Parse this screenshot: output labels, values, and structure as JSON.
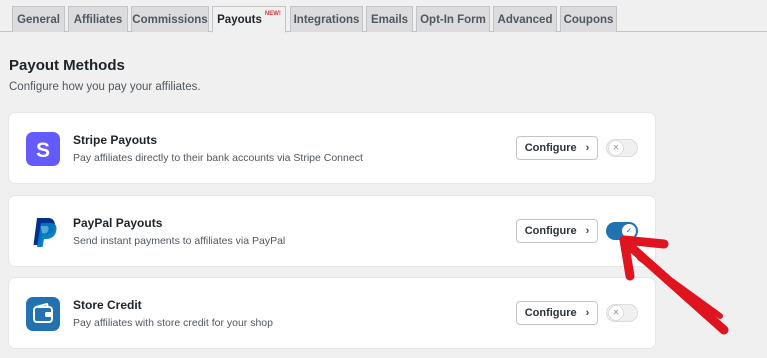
{
  "tabs": [
    {
      "label": "General"
    },
    {
      "label": "Affiliates"
    },
    {
      "label": "Commissions"
    },
    {
      "label": "Payouts",
      "badge": "NEW!",
      "active": true
    },
    {
      "label": "Integrations"
    },
    {
      "label": "Emails"
    },
    {
      "label": "Opt-In Form"
    },
    {
      "label": "Advanced"
    },
    {
      "label": "Coupons"
    }
  ],
  "heading": {
    "title": "Payout Methods",
    "description": "Configure how you pay your affiliates."
  },
  "methods": [
    {
      "name": "Stripe Payouts",
      "description": "Pay affiliates directly to their bank accounts via Stripe Connect",
      "icon": "stripe-logo-icon",
      "button_label": "Configure",
      "enabled": false
    },
    {
      "name": "PayPal Payouts",
      "description": "Send instant payments to affiliates via PayPal",
      "icon": "paypal-logo-icon",
      "button_label": "Configure",
      "enabled": true
    },
    {
      "name": "Store Credit",
      "description": "Pay affiliates with store credit for your shop",
      "icon": "wallet-icon",
      "button_label": "Configure",
      "enabled": false
    }
  ],
  "colors": {
    "accent": "#2271b1",
    "stripe": "#635bff",
    "store_credit": "#2271b1",
    "new_badge": "#d63638",
    "annotation_arrow": "#e0141e"
  }
}
